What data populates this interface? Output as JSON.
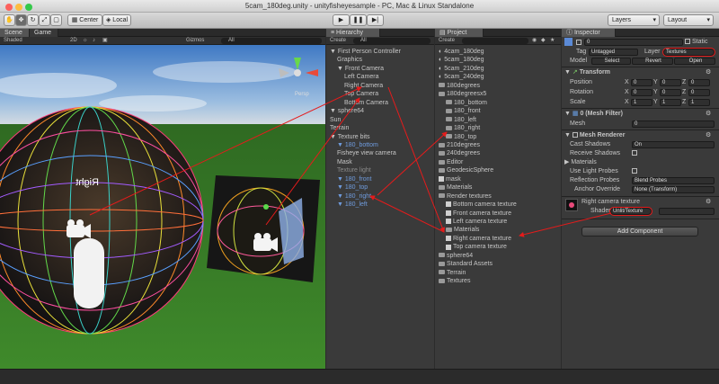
{
  "window": {
    "title": "5cam_180deg.unity - unityfisheyesample - PC, Mac & Linux Standalone"
  },
  "toolbar": {
    "center": "Center",
    "local": "Local",
    "layers": "Layers",
    "layout": "Layout"
  },
  "scene": {
    "tab_scene": "Scene",
    "tab_game": "Game",
    "shading": "Shaded",
    "mode_2d": "2D",
    "gizmos": "Gizmos",
    "all": "All",
    "label_right": "Right",
    "persp": "Persp"
  },
  "hierarchy": {
    "tab": "Hierarchy",
    "create": "Create",
    "search": "All",
    "items": [
      {
        "label": "First Person Controller",
        "indent": 0,
        "arrow": true,
        "style": ""
      },
      {
        "label": "Graphics",
        "indent": 1,
        "arrow": false,
        "style": ""
      },
      {
        "label": "Front Camera",
        "indent": 1,
        "arrow": true,
        "style": ""
      },
      {
        "label": "Left Camera",
        "indent": 2,
        "arrow": false,
        "style": ""
      },
      {
        "label": "Right Camera",
        "indent": 2,
        "arrow": false,
        "style": ""
      },
      {
        "label": "Top Camera",
        "indent": 2,
        "arrow": false,
        "style": ""
      },
      {
        "label": "Bottom Camera",
        "indent": 2,
        "arrow": false,
        "style": ""
      },
      {
        "label": "sphere64",
        "indent": 0,
        "arrow": true,
        "style": ""
      },
      {
        "label": "Sun",
        "indent": 0,
        "arrow": false,
        "style": ""
      },
      {
        "label": "Terrain",
        "indent": 0,
        "arrow": false,
        "style": ""
      },
      {
        "label": "Texture bits",
        "indent": 0,
        "arrow": true,
        "style": ""
      },
      {
        "label": "180_bottom",
        "indent": 1,
        "arrow": true,
        "style": "blue"
      },
      {
        "label": "Fisheye view camera",
        "indent": 1,
        "arrow": false,
        "style": ""
      },
      {
        "label": "Mask",
        "indent": 1,
        "arrow": false,
        "style": ""
      },
      {
        "label": "Texture light",
        "indent": 1,
        "arrow": false,
        "style": "grey"
      },
      {
        "label": "180_front",
        "indent": 1,
        "arrow": true,
        "style": "blue"
      },
      {
        "label": "180_top",
        "indent": 1,
        "arrow": true,
        "style": "blue"
      },
      {
        "label": "180_right",
        "indent": 1,
        "arrow": true,
        "style": "blue"
      },
      {
        "label": "180_left",
        "indent": 1,
        "arrow": true,
        "style": "blue"
      }
    ]
  },
  "project": {
    "tab": "Project",
    "create": "Create",
    "items": [
      {
        "label": "4cam_180deg",
        "indent": 0,
        "icon": "unity"
      },
      {
        "label": "5cam_180deg",
        "indent": 0,
        "icon": "unity"
      },
      {
        "label": "5cam_210deg",
        "indent": 0,
        "icon": "unity"
      },
      {
        "label": "5cam_240deg",
        "indent": 0,
        "icon": "unity"
      },
      {
        "label": "180degrees",
        "indent": 0,
        "icon": "folder"
      },
      {
        "label": "180degreesx5",
        "indent": 0,
        "icon": "folder"
      },
      {
        "label": "180_bottom",
        "indent": 1,
        "icon": "folder"
      },
      {
        "label": "180_front",
        "indent": 1,
        "icon": "folder"
      },
      {
        "label": "180_left",
        "indent": 1,
        "icon": "folder"
      },
      {
        "label": "180_right",
        "indent": 1,
        "icon": "folder"
      },
      {
        "label": "180_top",
        "indent": 1,
        "icon": "folder"
      },
      {
        "label": "210degrees",
        "indent": 0,
        "icon": "folder"
      },
      {
        "label": "240degrees",
        "indent": 0,
        "icon": "folder"
      },
      {
        "label": "Editor",
        "indent": 0,
        "icon": "folder"
      },
      {
        "label": "GeodesicSphere",
        "indent": 0,
        "icon": "folder"
      },
      {
        "label": "mask",
        "indent": 0,
        "icon": "file"
      },
      {
        "label": "Materials",
        "indent": 0,
        "icon": "folder"
      },
      {
        "label": "Render textures",
        "indent": 0,
        "icon": "folder"
      },
      {
        "label": "Bottom camera texture",
        "indent": 1,
        "icon": "file"
      },
      {
        "label": "Front camera texture",
        "indent": 1,
        "icon": "file"
      },
      {
        "label": "Left camera texture",
        "indent": 1,
        "icon": "file"
      },
      {
        "label": "Materials",
        "indent": 1,
        "icon": "folder"
      },
      {
        "label": "Right camera texture",
        "indent": 1,
        "icon": "file"
      },
      {
        "label": "Top camera texture",
        "indent": 1,
        "icon": "file"
      },
      {
        "label": "sphere64",
        "indent": 0,
        "icon": "folder"
      },
      {
        "label": "Standard Assets",
        "indent": 0,
        "icon": "folder"
      },
      {
        "label": "Terrain",
        "indent": 0,
        "icon": "folder"
      },
      {
        "label": "Textures",
        "indent": 0,
        "icon": "folder"
      }
    ]
  },
  "inspector": {
    "tab": "Inspector",
    "name": "0",
    "static": "Static",
    "tag_label": "Tag",
    "tag_value": "Untagged",
    "layer_label": "Layer",
    "layer_value": "Textures",
    "model_label": "Model",
    "select": "Select",
    "revert": "Revert",
    "open": "Open",
    "transform_title": "Transform",
    "position": "Position",
    "rotation": "Rotation",
    "scale": "Scale",
    "x": "X",
    "y": "Y",
    "z": "Z",
    "pos": [
      "0",
      "0",
      "0"
    ],
    "rot": [
      "0",
      "0",
      "0"
    ],
    "scl": [
      "1",
      "1",
      "1"
    ],
    "meshfilter_title": "0 (Mesh Filter)",
    "mesh_label": "Mesh",
    "mesh_value": "0",
    "renderer_title": "Mesh Renderer",
    "cast_shadows": "Cast Shadows",
    "cast_value": "On",
    "receive_shadows": "Receive Shadows",
    "materials": "Materials",
    "use_light_probes": "Use Light Probes",
    "reflection_probes": "Reflection Probes",
    "reflection_value": "Blend Probes",
    "anchor_override": "Anchor Override",
    "anchor_value": "None (Transform)",
    "material_name": "Right camera texture",
    "shader_label": "Shader",
    "shader_value": "Unlit/Texture",
    "add_component": "Add Component"
  },
  "colors": {
    "annotation": "#e51b1b",
    "selection": "#3e5f96",
    "panel": "#3a3a3a"
  }
}
